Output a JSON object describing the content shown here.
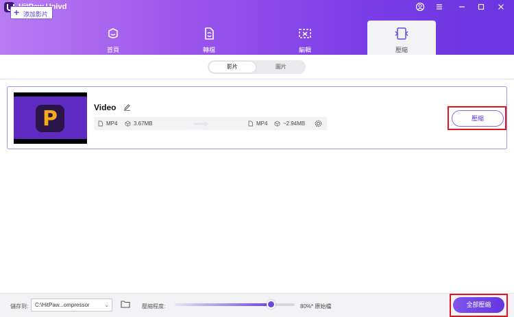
{
  "app": {
    "title": "HitPaw Univd"
  },
  "tabs": [
    {
      "label": "首頁",
      "icon": "home-icon"
    },
    {
      "label": "轉檔",
      "icon": "convert-icon"
    },
    {
      "label": "編輯",
      "icon": "edit-video-icon"
    },
    {
      "label": "壓縮",
      "icon": "compress-icon",
      "active": true
    }
  ],
  "toolbar": {
    "add_label": "添加影片",
    "segments": [
      {
        "label": "影片",
        "selected": true
      },
      {
        "label": "圖片",
        "selected": false
      }
    ]
  },
  "file": {
    "name": "Video",
    "source_format": "MP4",
    "source_size": "3.67MB",
    "target_format": "MP4",
    "target_size": "~2.94MB",
    "compress_label": "壓縮"
  },
  "footer": {
    "save_to_label": "儲存到:",
    "save_path": "C:\\HitPaw...ompressor",
    "level_label": "壓縮程度:",
    "level_value": "80%* 原始檔",
    "level_fraction": 0.8,
    "compress_all_label": "全部壓縮"
  },
  "colors": {
    "accent": "#6b47e0",
    "highlight_box": "#e0141e",
    "header_start": "#b97cf2",
    "header_end": "#6a35e0"
  }
}
